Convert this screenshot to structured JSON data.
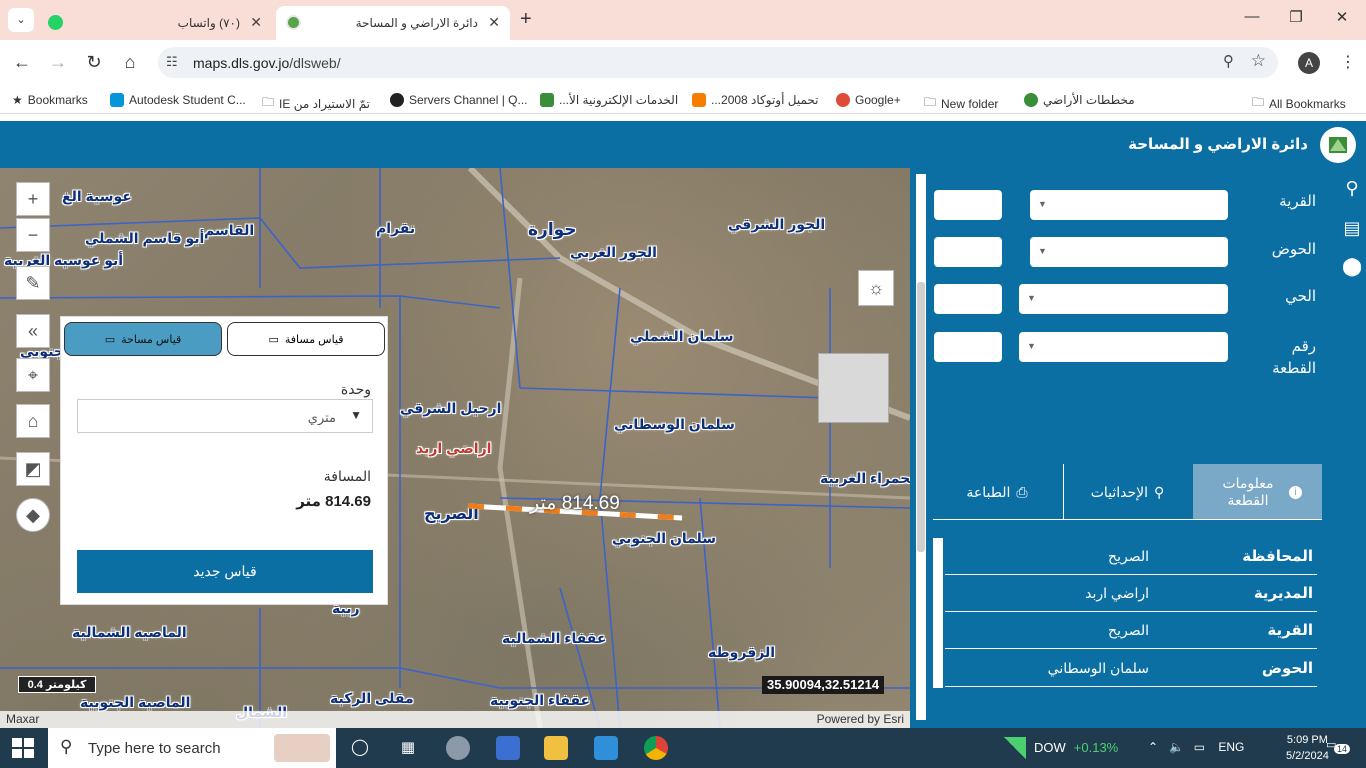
{
  "browser": {
    "tabs": [
      {
        "title": "(٧٠) واتساب",
        "active": false
      },
      {
        "title": "دائرة الاراضي و المساحة",
        "active": true
      }
    ],
    "url_host": "maps.dls.gov.jo",
    "url_path": "/dlsweb/",
    "profile_initial": "A",
    "bookmarks": [
      "Bookmarks",
      "Autodesk Student C...",
      "تمّ الاستيراد من IE",
      "Servers Channel | Q...",
      "الخدمات الإلكترونية الأ...",
      "تحميل أوتوكاد 2008...",
      "Google+",
      "New folder",
      "مخططات الأراضي"
    ],
    "all_bookmarks": "All Bookmarks"
  },
  "header": {
    "title": "دائرة الاراضي و المساحة"
  },
  "map": {
    "labels": [
      "عوسية الغ",
      "أبو قاسم الشملي",
      "أبو عوسيه الغربية",
      "القاسم",
      "نقرام",
      "حوارة",
      "الجور الشرقي",
      "الجور الغربي",
      "سلمان الشملي",
      "ارحيل الشرقي",
      "اراضي اربد",
      "سلمان الوسطاني",
      "الحمراء الغربية",
      "سلمان الجنوبي",
      "الصريح",
      "الماصيه الشمالية",
      "عقفاء الشمالية",
      "الزقروطه",
      "مقلى الركبة",
      "عقفاء الجنوبية",
      "الماصية الجنوبية",
      "جنوبي",
      "ربية",
      "الشمال"
    ],
    "measure_line_label": "814.69 متر",
    "scale": "0.4 كيلومتر",
    "coordinates": "35.90094,32.51214",
    "attribution_left": "Maxar",
    "attribution_right": "Powered by Esri"
  },
  "measure": {
    "tab_distance": "قياس مسافة",
    "tab_area": "قياس مساحة",
    "unit_label": "وحدة",
    "unit_value": "متري",
    "distance_label": "المسافة",
    "distance_value": "814.69 متر",
    "new_button": "قياس جديد"
  },
  "search_panel": {
    "fields": [
      {
        "label": "القرية"
      },
      {
        "label": "الحوض"
      },
      {
        "label": "الحي"
      },
      {
        "label": "رقم القطعة"
      }
    ]
  },
  "info": {
    "tabs": [
      "معلومات القطعة",
      "الإحداثيات",
      "الطباعة"
    ],
    "rows": [
      {
        "key": "المحافظة",
        "value": "الصريح"
      },
      {
        "key": "المديرية",
        "value": "اراضي اربد"
      },
      {
        "key": "القرية",
        "value": "الصريح"
      },
      {
        "key": "الحوض",
        "value": "سلمان الوسطاني"
      }
    ]
  },
  "taskbar": {
    "search_placeholder": "Type here to search",
    "ticker": "DOW",
    "ticker_change": "+0.13%",
    "language": "ENG",
    "time": "5:09 PM",
    "date": "5/2/2024",
    "notifications": "14"
  }
}
